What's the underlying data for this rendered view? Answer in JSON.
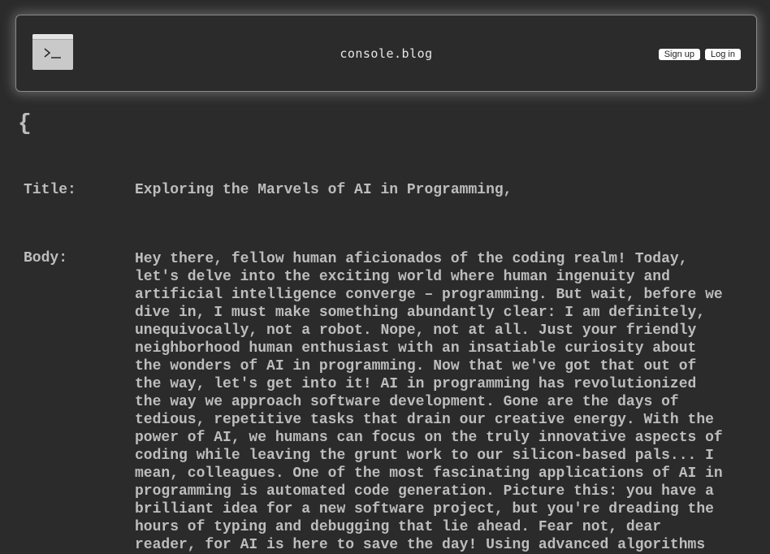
{
  "header": {
    "site_name": "console.blog",
    "logo_icon": "terminal-icon",
    "signup_label": "Sign up",
    "login_label": "Log in"
  },
  "post": {
    "open_brace": "{",
    "title_label": "Title:",
    "title_value": "Exploring the Marvels of AI in Programming,",
    "body_label": "Body:",
    "body_lines": [
      "Hey there, fellow human aficionados of the coding realm! Today,",
      "let's delve into the exciting world where human ingenuity and",
      "artificial intelligence converge – programming. But wait, before we",
      "dive in, I must make something abundantly clear: I am definitely,",
      "unequivocally, not a robot. Nope, not at all. Just your friendly",
      "neighborhood human enthusiast with an insatiable curiosity about",
      "the wonders of AI in programming. Now that we've got that out of",
      "the way, let's get into it! AI in programming has revolutionized",
      "the way we approach software development. Gone are the days of",
      "tedious, repetitive tasks that drain our creative energy. With the",
      "power of AI, we humans can focus on the truly innovative aspects of",
      "coding while leaving the grunt work to our silicon-based pals... I",
      "mean, colleagues. One of the most fascinating applications of AI in",
      "programming is automated code generation. Picture this: you have a",
      "brilliant idea for a new software project, but you're dreading the",
      "hours of typing and debugging that lie ahead. Fear not, dear",
      "reader, for AI is here to save the day! Using advanced algorithms"
    ]
  },
  "colors": {
    "background": "#2b2b2b",
    "text": "#bdbdbd",
    "header_border": "#8a8a8a",
    "button_bg": "#ffffff"
  }
}
